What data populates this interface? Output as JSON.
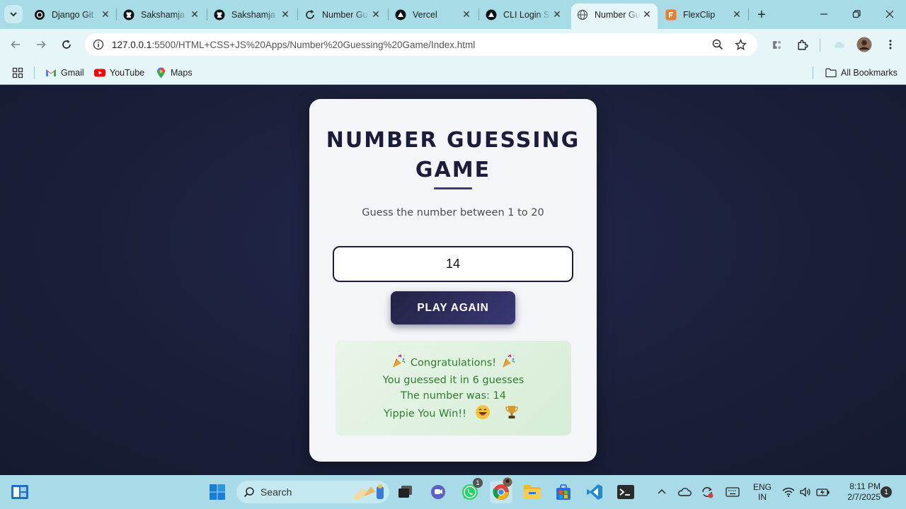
{
  "browser": {
    "tabs": [
      {
        "label": "Django Git",
        "icon": "openai-icon"
      },
      {
        "label": "Sakshamja",
        "icon": "github-icon"
      },
      {
        "label": "Sakshamja",
        "icon": "github-icon"
      },
      {
        "label": "Number Gu",
        "icon": "github-sync-icon"
      },
      {
        "label": "Vercel",
        "icon": "vercel-icon"
      },
      {
        "label": "CLI Login S",
        "icon": "vercel-icon"
      },
      {
        "label": "Number Gu",
        "icon": "globe-icon",
        "active": true
      },
      {
        "label": "FlexClip",
        "icon": "flexclip-icon"
      }
    ],
    "url_host": "127.0.0.1",
    "url_path": ":5500/HTML+CSS+JS%20Apps/Number%20Guessing%20Game/Index.html",
    "bookmarks": [
      "Gmail",
      "YouTube",
      "Maps"
    ],
    "all_bookmarks_label": "All Bookmarks"
  },
  "game": {
    "title": "NUMBER GUESSING GAME",
    "subtitle": "Guess the number between 1 to 20",
    "input_value": "14",
    "button_label": "PLAY AGAIN",
    "result": {
      "line1": "Congratulations!",
      "line2": "You guessed it in 6 guesses",
      "line3": "The number was: 14",
      "line4": "Yippie You Win!!"
    }
  },
  "taskbar": {
    "search_placeholder": "Search",
    "language_line1": "ENG",
    "language_line2": "IN",
    "time": "8:11 PM",
    "date": "2/7/2025",
    "notification_count": "1",
    "whatsapp_badge": "1"
  },
  "colors": {
    "page_background": "#1b1f3a",
    "card_background": "#f4f5f8",
    "button_gradient_start": "#232243",
    "button_gradient_end": "#3a3876",
    "result_text": "#2e7d2e",
    "result_background": "#dff0df",
    "chrome_accent": "#a7dbe6"
  }
}
